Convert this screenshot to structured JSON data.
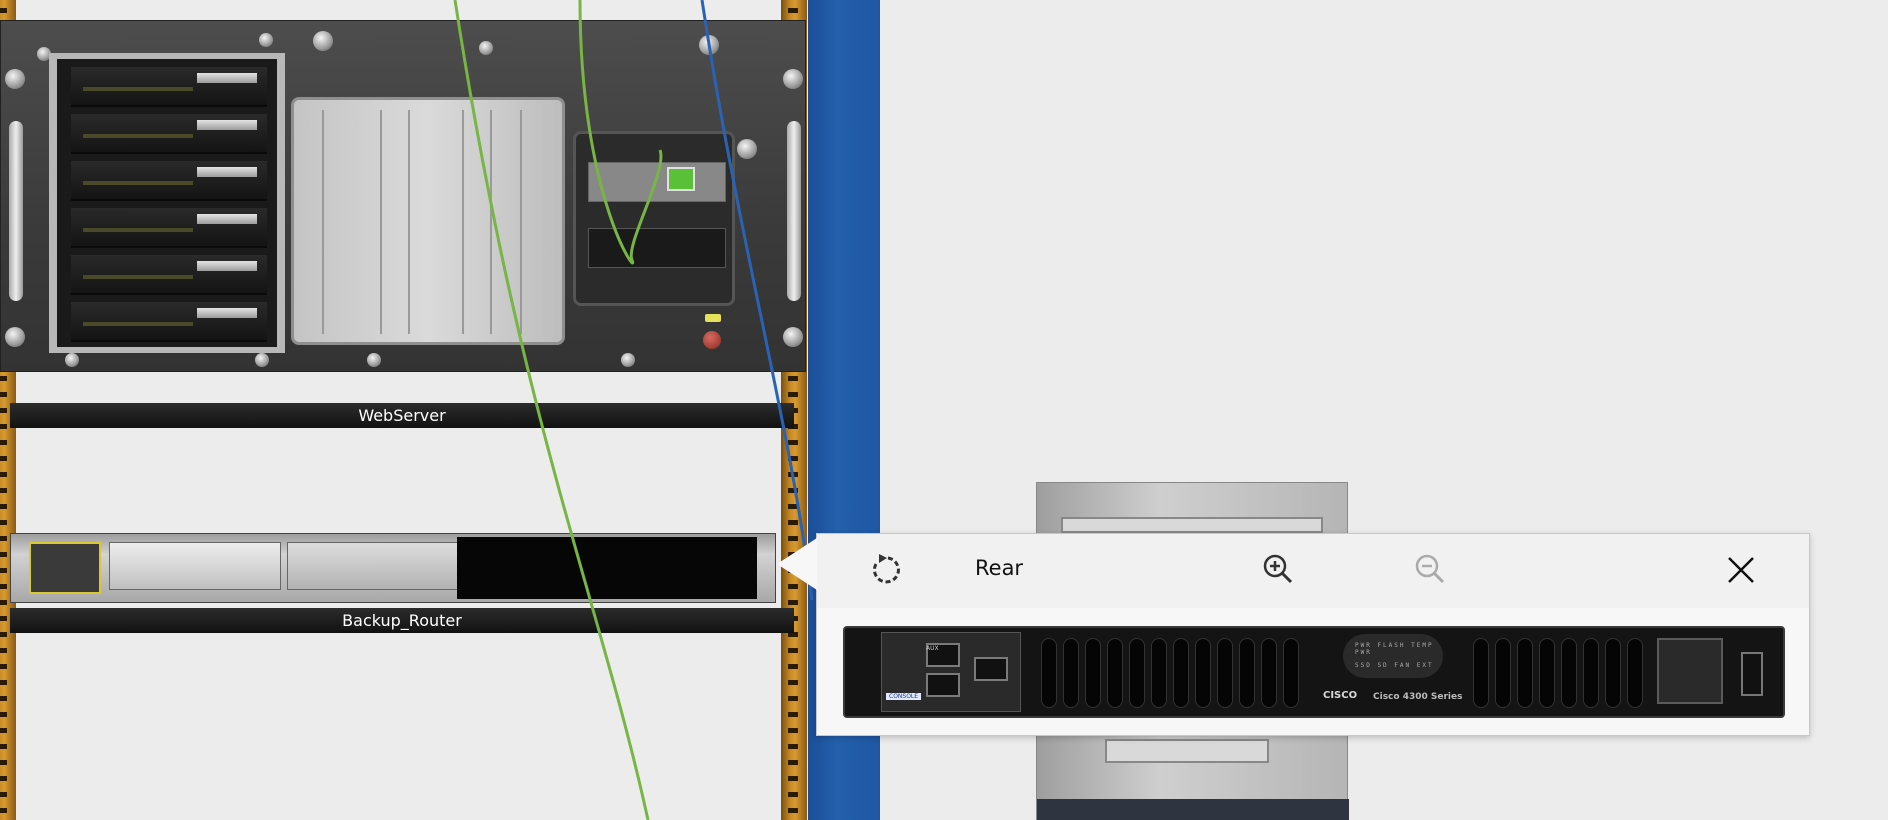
{
  "rack": {
    "devices": [
      {
        "label": "WebServer"
      },
      {
        "label": "Backup_Router"
      }
    ]
  },
  "cable_colors": {
    "green": "#77b544",
    "blue": "#2a62b4"
  },
  "popup": {
    "view_label": "Rear",
    "rotate_icon": "rotate-icon",
    "zoom_in_icon": "zoom-in-icon",
    "zoom_out_icon": "zoom-out-icon",
    "close_icon": "close-icon",
    "zoom_out_enabled": false,
    "rear_panel": {
      "brand": "CISCO",
      "model": "Cisco 4300 Series",
      "console_label": "CONSOLE",
      "aux_label": "AUX",
      "led_labels_top": "PWR  FLASH  TEMP  PWR",
      "led_labels_bottom": "SSD  SD  FAN  EXT"
    }
  },
  "colors": {
    "rack_rail": "#c68a25",
    "frame_blue": "#2460ac",
    "label_bg": "#1a1a1a",
    "label_text": "#ffffff"
  }
}
